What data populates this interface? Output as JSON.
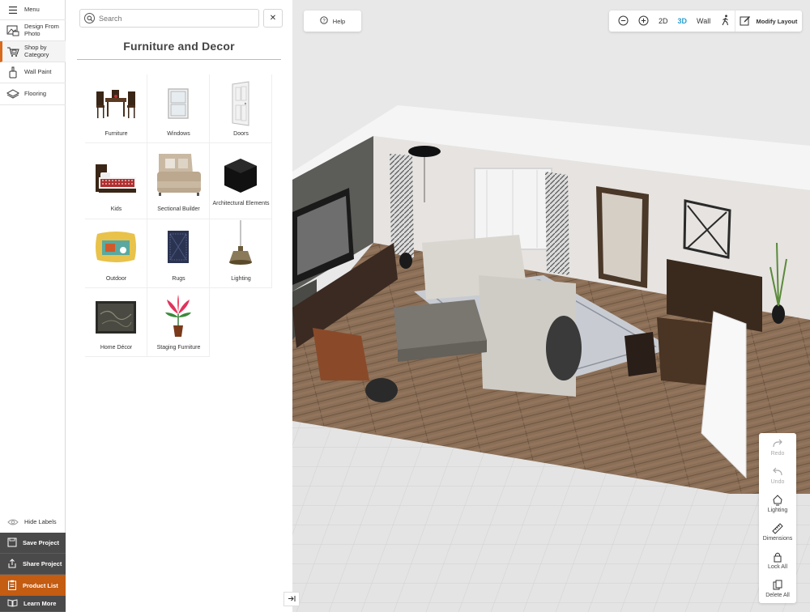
{
  "nav": {
    "menu_label": "Menu",
    "items": [
      {
        "label": "Design From Photo"
      },
      {
        "label": "Shop by Category"
      },
      {
        "label": "Wall Paint"
      },
      {
        "label": "Flooring"
      }
    ],
    "hide_labels": "Hide Labels",
    "save_project": "Save Project",
    "share_project": "Share Project",
    "product_list": "Product List",
    "learn_more": "Learn More",
    "active_accent": "#d86a1e"
  },
  "panel": {
    "search_placeholder": "Search",
    "title": "Furniture and Decor",
    "categories": [
      {
        "label": "Furniture",
        "icon": "dining-set-icon"
      },
      {
        "label": "Windows",
        "icon": "window-icon"
      },
      {
        "label": "Doors",
        "icon": "door-icon"
      },
      {
        "label": "Kids",
        "icon": "kids-bed-icon"
      },
      {
        "label": "Sectional Builder",
        "icon": "sectional-sofa-icon"
      },
      {
        "label": "Architectural Elements",
        "icon": "cube-icon"
      },
      {
        "label": "Outdoor",
        "icon": "pillow-icon"
      },
      {
        "label": "Rugs",
        "icon": "rug-icon"
      },
      {
        "label": "Lighting",
        "icon": "pendant-lamp-icon"
      },
      {
        "label": "Home Décor",
        "icon": "wall-art-icon"
      },
      {
        "label": "Staging Furniture",
        "icon": "plant-icon"
      }
    ]
  },
  "viewport": {
    "help_label": "Help",
    "toolbar": {
      "mode_2d": "2D",
      "mode_3d": "3D",
      "wall": "Wall",
      "modify_layout": "Modify Layout",
      "active_mode": "3D",
      "active_color": "#2a9fd0"
    },
    "tools": {
      "redo": "Redo",
      "undo": "Undo",
      "lighting": "Lighting",
      "dimensions": "Dimensions",
      "lock_all": "Lock All",
      "delete_all": "Delete All"
    }
  }
}
